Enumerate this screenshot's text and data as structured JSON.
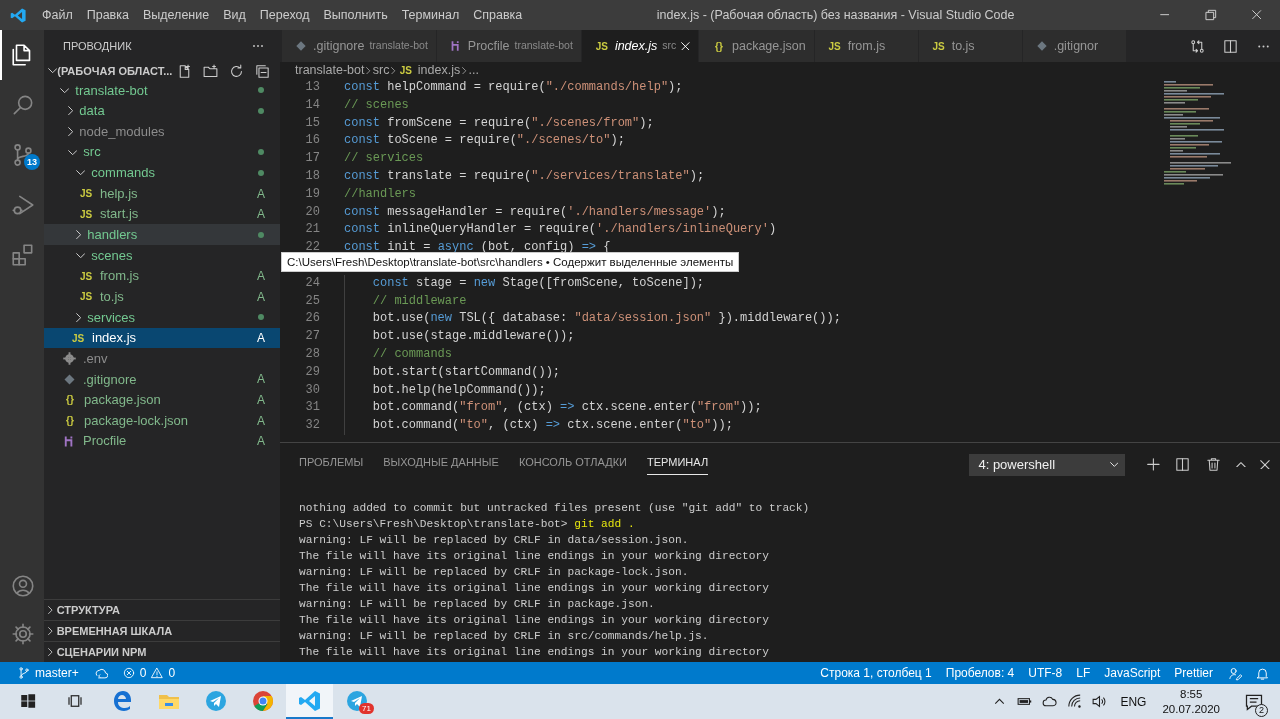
{
  "window": {
    "title": "index.js - (Рабочая область) без названия - Visual Studio Code"
  },
  "menu": [
    "Файл",
    "Правка",
    "Выделение",
    "Вид",
    "Переход",
    "Выполнить",
    "Терминал",
    "Справка"
  ],
  "activity_bar": {
    "top": [
      {
        "kind": "explorer",
        "selected": true
      },
      {
        "kind": "search",
        "selected": false
      },
      {
        "kind": "scm",
        "selected": false,
        "badge": "13"
      },
      {
        "kind": "run",
        "selected": false
      },
      {
        "kind": "extensions",
        "selected": false
      }
    ],
    "bottom": [
      {
        "kind": "account"
      },
      {
        "kind": "settings"
      }
    ]
  },
  "sidebar": {
    "title": "ПРОВОДНИК",
    "workspace": "(РАБОЧАЯ ОБЛАСТ...",
    "tree": [
      {
        "label": "translate-bot",
        "kind": "folder",
        "ignored": false,
        "changed": true,
        "expanded": true,
        "selected": false,
        "hovered": false,
        "children": [
          {
            "label": "data",
            "kind": "folder",
            "ignored": false,
            "changed": true,
            "expanded": false,
            "selected": false,
            "hovered": false
          },
          {
            "label": "node_modules",
            "kind": "folder",
            "ignored": true,
            "changed": false,
            "expanded": false,
            "selected": false,
            "hovered": false
          },
          {
            "label": "src",
            "kind": "folder",
            "ignored": false,
            "changed": true,
            "expanded": true,
            "selected": false,
            "hovered": false,
            "children": [
              {
                "label": "commands",
                "kind": "folder",
                "ignored": false,
                "changed": true,
                "expanded": true,
                "selected": false,
                "hovered": false,
                "children": [
                  {
                    "label": "help.js",
                    "kind": "js",
                    "icon": "JS",
                    "ignored": false,
                    "badge": "A",
                    "selected": false,
                    "hovered": false
                  },
                  {
                    "label": "start.js",
                    "kind": "js",
                    "icon": "JS",
                    "ignored": false,
                    "badge": "A",
                    "selected": false,
                    "hovered": false
                  }
                ]
              },
              {
                "label": "handlers",
                "kind": "folder",
                "ignored": false,
                "changed": true,
                "expanded": false,
                "selected": false,
                "hovered": true
              },
              {
                "label": "scenes",
                "kind": "folder",
                "ignored": false,
                "changed": false,
                "expanded": true,
                "selected": false,
                "hovered": false,
                "children": [
                  {
                    "label": "from.js",
                    "kind": "js",
                    "icon": "JS",
                    "ignored": false,
                    "badge": "A",
                    "selected": false,
                    "hovered": false
                  },
                  {
                    "label": "to.js",
                    "kind": "js",
                    "icon": "JS",
                    "ignored": false,
                    "badge": "A",
                    "selected": false,
                    "hovered": false
                  }
                ]
              },
              {
                "label": "services",
                "kind": "folder",
                "ignored": false,
                "changed": true,
                "expanded": false,
                "selected": false,
                "hovered": false
              },
              {
                "label": "index.js",
                "kind": "js",
                "icon": "JS",
                "ignored": false,
                "badge": "A",
                "selected": true,
                "hovered": false
              }
            ]
          },
          {
            "label": ".env",
            "kind": "config",
            "ignored": true,
            "selected": false,
            "hovered": false
          },
          {
            "label": ".gitignore",
            "kind": "git",
            "ignored": false,
            "badge": "A",
            "selected": false,
            "hovered": false
          },
          {
            "label": "package.json",
            "kind": "json",
            "icon": "{}",
            "ignored": false,
            "badge": "A",
            "selected": false,
            "hovered": false
          },
          {
            "label": "package-lock.json",
            "kind": "json",
            "icon": "{}",
            "ignored": false,
            "badge": "A",
            "selected": false,
            "hovered": false
          },
          {
            "label": "Procfile",
            "kind": "procfile",
            "ignored": false,
            "badge": "A",
            "selected": false,
            "hovered": false
          }
        ]
      }
    ],
    "sections": [
      {
        "label": "СТРУКТУРА",
        "expanded": false
      },
      {
        "label": "ВРЕМЕННАЯ ШКАЛА",
        "expanded": false
      },
      {
        "label": "СЦЕНАРИИ NPM",
        "expanded": false
      }
    ]
  },
  "tooltip": "C:\\Users\\Fresh\\Desktop\\translate-bot\\src\\handlers • Содержит выделенные элементы",
  "tabs": [
    {
      "label": ".gitignore",
      "detail": "translate-bot",
      "kind": "git",
      "selected": false,
      "preview": false
    },
    {
      "label": "Procfile",
      "detail": "translate-bot",
      "kind": "procfile",
      "selected": false,
      "preview": false
    },
    {
      "label": "index.js",
      "detail": "src",
      "kind": "js",
      "icon": "JS",
      "selected": true,
      "preview": true
    },
    {
      "label": "package.json",
      "kind": "json",
      "icon": "{}",
      "selected": false,
      "preview": false
    },
    {
      "label": "from.js",
      "kind": "js",
      "icon": "JS",
      "selected": false,
      "preview": false
    },
    {
      "label": "to.js",
      "kind": "js",
      "icon": "JS",
      "selected": false,
      "preview": false
    },
    {
      "label": ".gitignor",
      "kind": "git",
      "selected": false,
      "preview": false
    }
  ],
  "breadcrumb": [
    {
      "label": "translate-bot"
    },
    {
      "label": "src"
    },
    {
      "label": "index.js",
      "kind": "js",
      "icon": "JS"
    },
    {
      "label": "..."
    }
  ],
  "code": [
    {
      "num": "13",
      "tokens": [
        {
          "kind": "keyword",
          "text": "const"
        },
        {
          "kind": "plain",
          "text": " helpCommand = require("
        },
        {
          "kind": "string",
          "text": "\"./commands/help\""
        },
        {
          "kind": "plain",
          "text": ");"
        }
      ]
    },
    {
      "num": "14",
      "tokens": [
        {
          "kind": "comment",
          "text": "// scenes"
        }
      ]
    },
    {
      "num": "15",
      "tokens": [
        {
          "kind": "keyword",
          "text": "const"
        },
        {
          "kind": "plain",
          "text": " fromScene = require("
        },
        {
          "kind": "string",
          "text": "\"./scenes/from\""
        },
        {
          "kind": "plain",
          "text": ");"
        }
      ]
    },
    {
      "num": "16",
      "tokens": [
        {
          "kind": "keyword",
          "text": "const"
        },
        {
          "kind": "plain",
          "text": " toScene = require("
        },
        {
          "kind": "string",
          "text": "\"./scenes/to\""
        },
        {
          "kind": "plain",
          "text": ");"
        }
      ]
    },
    {
      "num": "17",
      "tokens": [
        {
          "kind": "comment",
          "text": "// services"
        }
      ]
    },
    {
      "num": "18",
      "tokens": [
        {
          "kind": "keyword",
          "text": "const"
        },
        {
          "kind": "plain",
          "text": " translate = require("
        },
        {
          "kind": "string",
          "text": "\"./services/translate\""
        },
        {
          "kind": "plain",
          "text": ");"
        }
      ]
    },
    {
      "num": "19",
      "tokens": [
        {
          "kind": "comment",
          "text": "//handlers"
        }
      ]
    },
    {
      "num": "20",
      "tokens": [
        {
          "kind": "keyword",
          "text": "const"
        },
        {
          "kind": "plain",
          "text": " messageHandler = require("
        },
        {
          "kind": "string",
          "text": "'./handlers/message'"
        },
        {
          "kind": "plain",
          "text": ");"
        }
      ]
    },
    {
      "num": "21",
      "tokens": [
        {
          "kind": "keyword",
          "text": "const"
        },
        {
          "kind": "plain",
          "text": " inlineQueryHandler = require("
        },
        {
          "kind": "string",
          "text": "'./handlers/inlineQuery'"
        },
        {
          "kind": "plain",
          "text": ")"
        }
      ]
    },
    {
      "num": "22",
      "tokens": [
        {
          "kind": "keyword",
          "text": "const"
        },
        {
          "kind": "plain",
          "text": " init = "
        },
        {
          "kind": "keyword",
          "text": "async"
        },
        {
          "kind": "plain",
          "text": " (bot, config) "
        },
        {
          "kind": "keyword",
          "text": "=>"
        },
        {
          "kind": "plain",
          "text": " {"
        }
      ],
      "children": [
        {
          "num": "24",
          "tokens": [
            {
              "kind": "keyword",
              "text": "const"
            },
            {
              "kind": "plain",
              "text": " stage = "
            },
            {
              "kind": "keyword",
              "text": "new"
            },
            {
              "kind": "plain",
              "text": " Stage([fromScene, toScene]);"
            }
          ]
        },
        {
          "num": "25",
          "tokens": [
            {
              "kind": "comment",
              "text": "// middleware"
            }
          ]
        },
        {
          "num": "26",
          "tokens": [
            {
              "kind": "plain",
              "text": "bot.use("
            },
            {
              "kind": "keyword",
              "text": "new"
            },
            {
              "kind": "plain",
              "text": " TSL({ database: "
            },
            {
              "kind": "string",
              "text": "\"data/session.json\""
            },
            {
              "kind": "plain",
              "text": " }).middleware());"
            }
          ]
        },
        {
          "num": "27",
          "tokens": [
            {
              "kind": "plain",
              "text": "bot.use(stage.middleware());"
            }
          ]
        },
        {
          "num": "28",
          "tokens": [
            {
              "kind": "comment",
              "text": "// commands"
            }
          ]
        },
        {
          "num": "29",
          "tokens": [
            {
              "kind": "plain",
              "text": "bot.start(startCommand());"
            }
          ]
        },
        {
          "num": "30",
          "tokens": [
            {
              "kind": "plain",
              "text": "bot.help(helpCommand());"
            }
          ]
        },
        {
          "num": "31",
          "tokens": [
            {
              "kind": "plain",
              "text": "bot.command("
            },
            {
              "kind": "string",
              "text": "\"from\""
            },
            {
              "kind": "plain",
              "text": ", (ctx) "
            },
            {
              "kind": "keyword",
              "text": "=>"
            },
            {
              "kind": "plain",
              "text": " ctx.scene.enter("
            },
            {
              "kind": "string",
              "text": "\"from\""
            },
            {
              "kind": "plain",
              "text": "));"
            }
          ]
        },
        {
          "num": "32",
          "tokens": [
            {
              "kind": "plain",
              "text": "bot.command("
            },
            {
              "kind": "string",
              "text": "\"to\""
            },
            {
              "kind": "plain",
              "text": ", (ctx) "
            },
            {
              "kind": "keyword",
              "text": "=>"
            },
            {
              "kind": "plain",
              "text": " ctx.scene.enter("
            },
            {
              "kind": "string",
              "text": "\"to\""
            },
            {
              "kind": "plain",
              "text": "));"
            }
          ]
        }
      ]
    }
  ],
  "panel": {
    "tabs": [
      {
        "label": "ПРОБЛЕМЫ",
        "selected": false
      },
      {
        "label": "ВЫХОДНЫЕ ДАННЫЕ",
        "selected": false
      },
      {
        "label": "КОНСОЛЬ ОТЛАДКИ",
        "selected": false
      },
      {
        "label": "ТЕРМИНАЛ",
        "selected": true
      }
    ],
    "terminal_select": "4: powershell",
    "actions": [
      {
        "kind": "add"
      },
      {
        "kind": "split"
      },
      {
        "kind": "trash"
      },
      {
        "kind": "maximize"
      },
      {
        "kind": "close"
      }
    ],
    "terminal": [
      {
        "kind": "output",
        "text": "nothing added to commit but untracked files present (use \"git add\" to track)"
      },
      {
        "kind": "prompt",
        "text": "PS C:\\Users\\Fresh\\Desktop\\translate-bot> ",
        "command": "git add ."
      },
      {
        "kind": "output",
        "text": "warning: LF will be replaced by CRLF in data/session.json."
      },
      {
        "kind": "output",
        "text": "The file will have its original line endings in your working directory"
      },
      {
        "kind": "output",
        "text": "warning: LF will be replaced by CRLF in package-lock.json."
      },
      {
        "kind": "output",
        "text": "The file will have its original line endings in your working directory"
      },
      {
        "kind": "output",
        "text": "warning: LF will be replaced by CRLF in package.json."
      },
      {
        "kind": "output",
        "text": "The file will have its original line endings in your working directory"
      },
      {
        "kind": "output",
        "text": "warning: LF will be replaced by CRLF in src/commands/help.js."
      },
      {
        "kind": "output",
        "text": "The file will have its original line endings in your working directory"
      }
    ]
  },
  "status_bar": {
    "branch": "master+",
    "errors": "0",
    "warnings": "0",
    "right": [
      "Строка 1, столбец 1",
      "Пробелов: 4",
      "UTF-8",
      "LF",
      "JavaScript",
      "Prettier"
    ]
  },
  "taskbar": {
    "apps": [
      {
        "kind": "windows",
        "selected": false
      },
      {
        "kind": "taskview",
        "selected": false
      },
      {
        "kind": "edge",
        "selected": false
      },
      {
        "kind": "folder",
        "selected": false
      },
      {
        "kind": "telegram",
        "selected": false
      },
      {
        "kind": "chrome",
        "selected": false
      },
      {
        "kind": "vscode",
        "selected": true
      },
      {
        "kind": "telegram",
        "selected": false,
        "badge": "71"
      }
    ],
    "tray": [
      {
        "kind": "up"
      },
      {
        "kind": "battery"
      },
      {
        "kind": "cloud"
      },
      {
        "kind": "wifi"
      },
      {
        "kind": "volume"
      }
    ],
    "language": "ENG",
    "time": "8:55",
    "date": "20.07.2020",
    "notifications": "2"
  }
}
